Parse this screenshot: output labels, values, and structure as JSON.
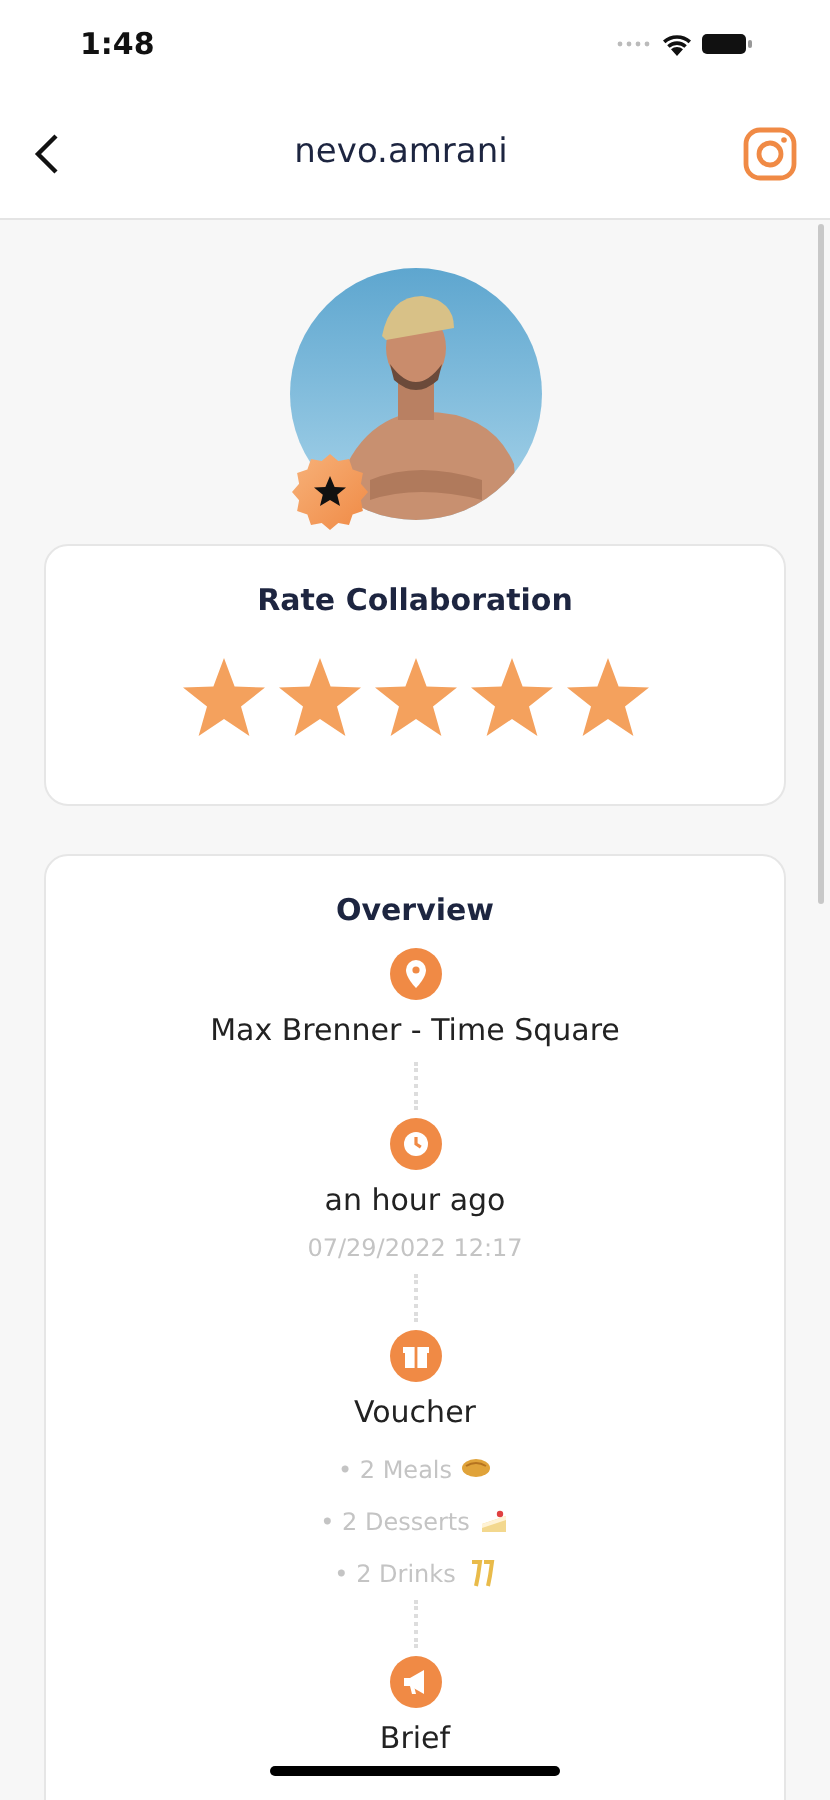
{
  "status_bar": {
    "time": "1:48"
  },
  "header": {
    "title": "nevo.amrani"
  },
  "rating": {
    "title": "Rate Collaboration",
    "stars": 5
  },
  "overview": {
    "title": "Overview",
    "items": [
      {
        "kind": "location",
        "title": "Max Brenner - Time Square"
      },
      {
        "kind": "time",
        "title": "an hour ago",
        "subtitle": "07/29/2022 12:17"
      },
      {
        "kind": "voucher",
        "title": "Voucher",
        "lines": [
          {
            "text": "• 2 Meals",
            "kind": "meal"
          },
          {
            "text": "• 2 Desserts",
            "kind": "dessert"
          },
          {
            "text": "• 2 Drinks",
            "kind": "drink"
          }
        ]
      },
      {
        "kind": "brief",
        "title": "Brief"
      }
    ]
  }
}
